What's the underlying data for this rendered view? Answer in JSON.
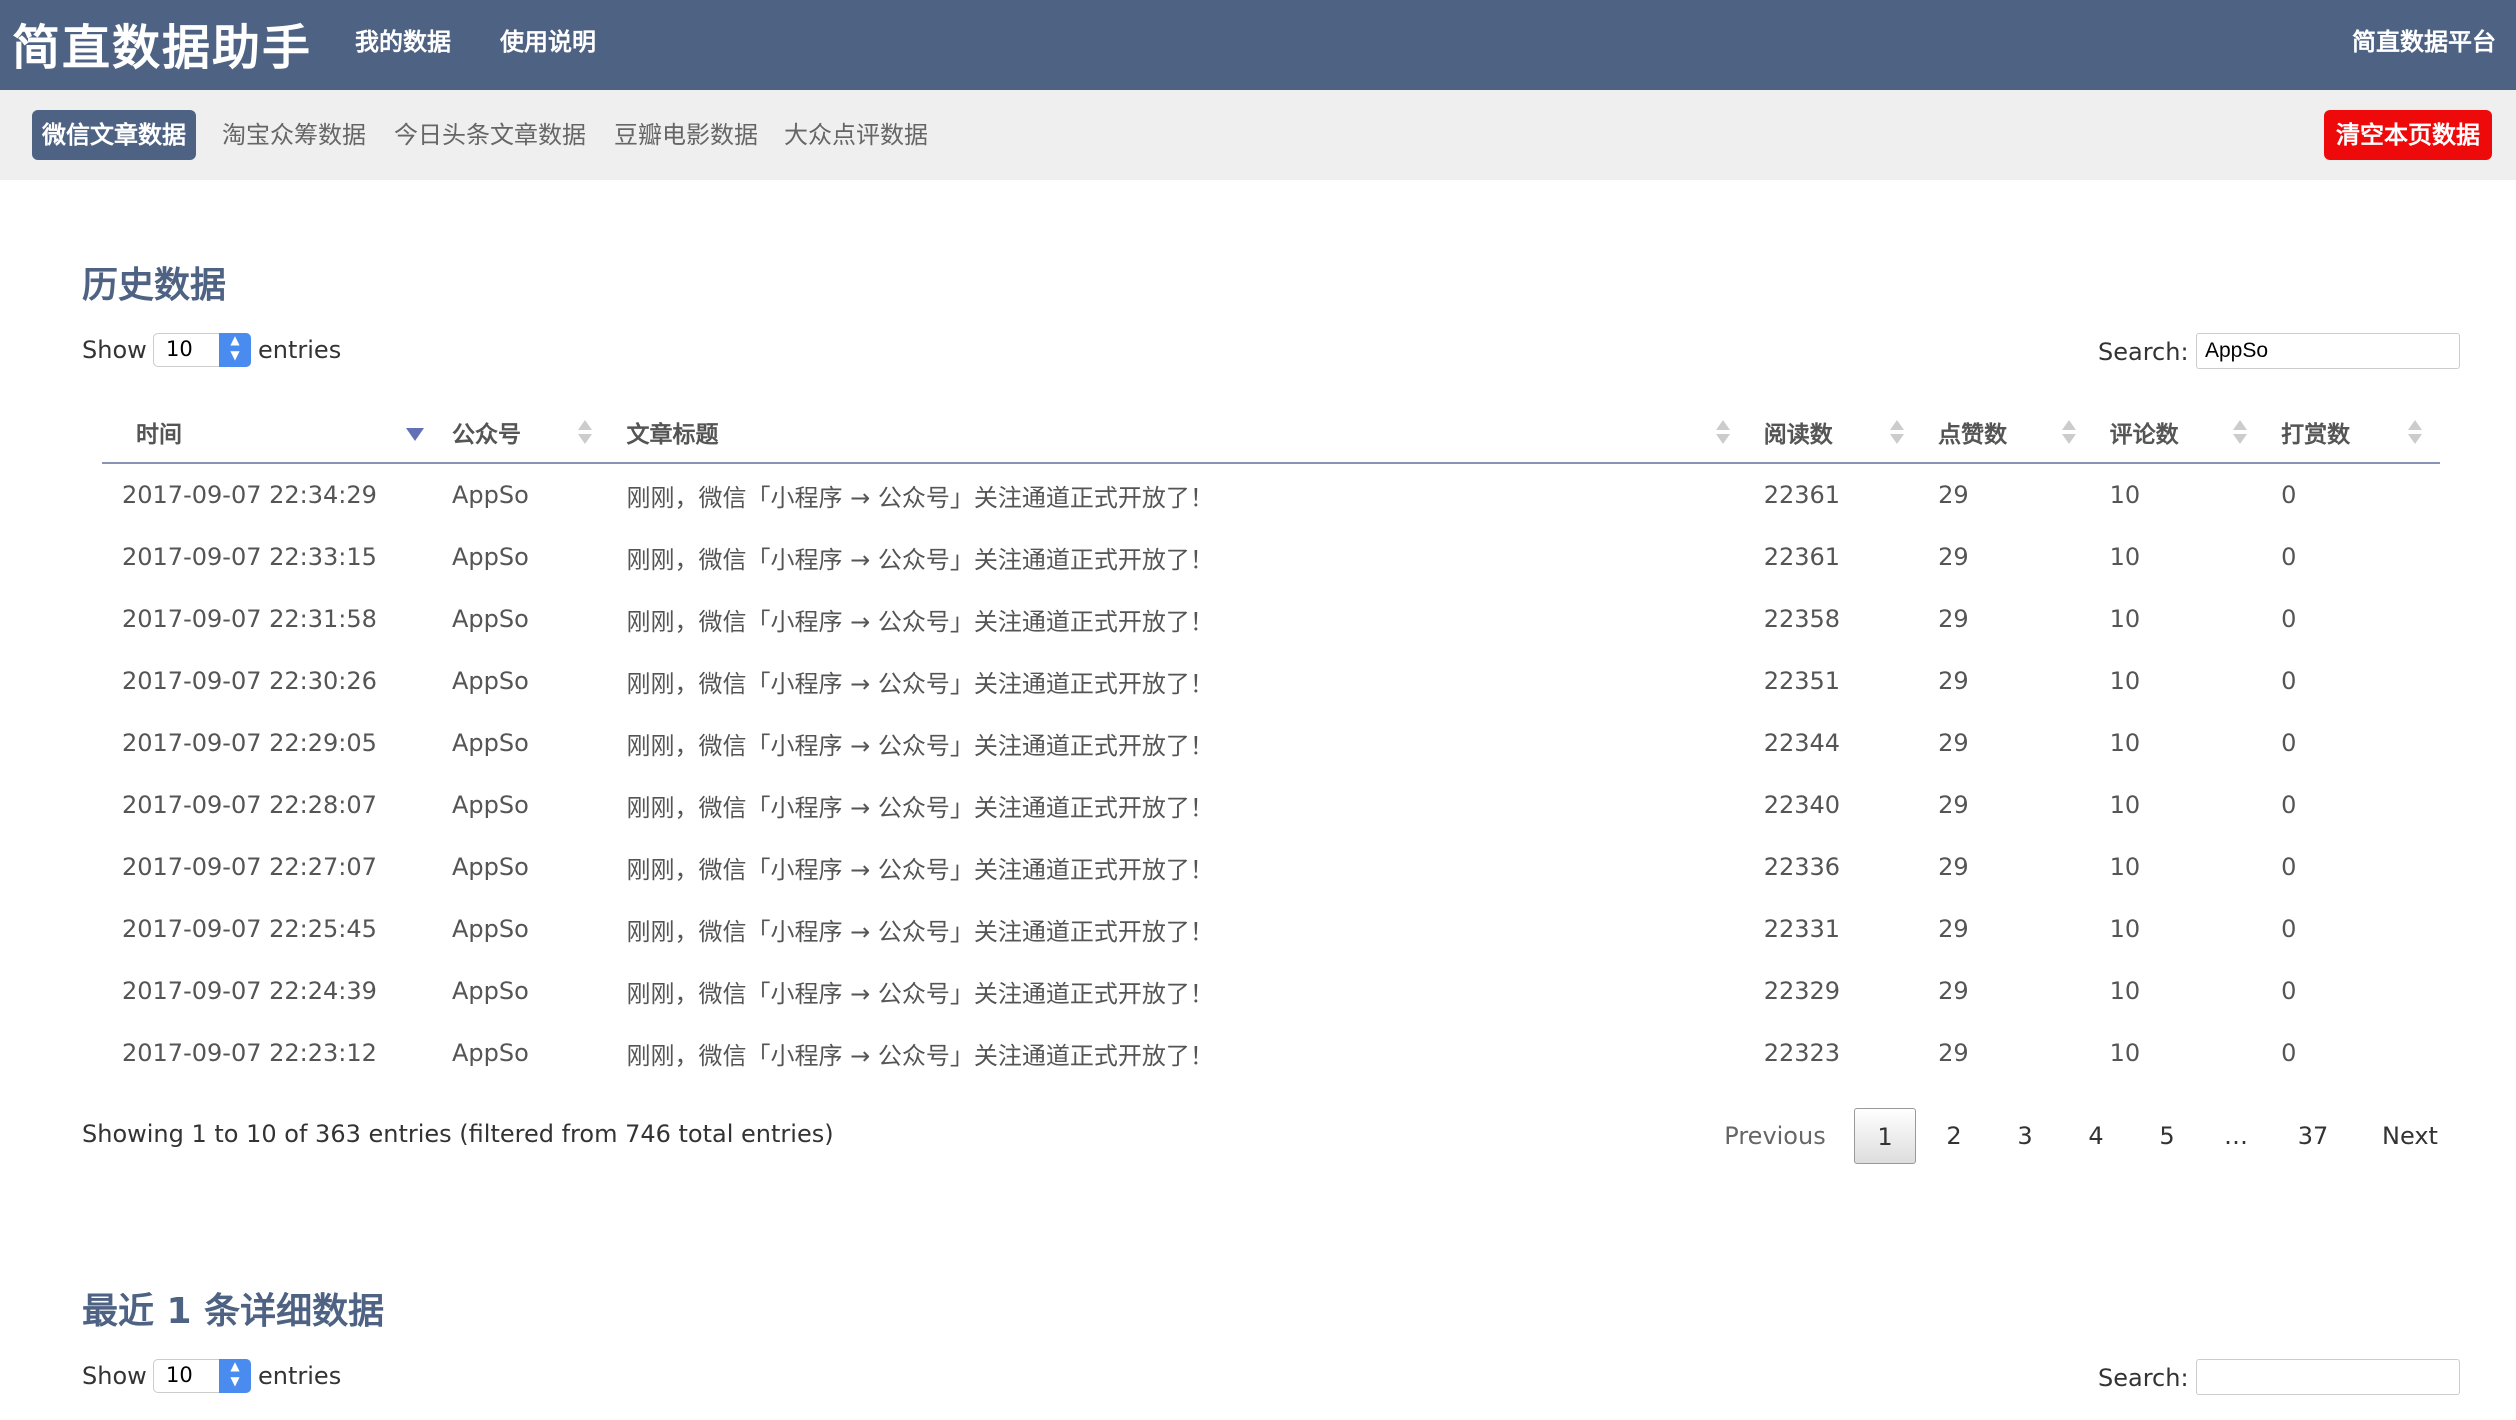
{
  "navbar": {
    "brand": "简直数据助手",
    "links": [
      "我的数据",
      "使用说明"
    ],
    "right_link": "简直数据平台"
  },
  "subnav": {
    "pills": [
      "微信文章数据",
      "淘宝众筹数据",
      "今日头条文章数据",
      "豆瓣电影数据",
      "大众点评数据"
    ],
    "active_index": 0,
    "clear_button": "清空本页数据"
  },
  "history": {
    "title": "历史数据",
    "show_label": "Show",
    "page_size": "10",
    "entries_label": "entries",
    "search_label": "Search:",
    "search_value": "AppSo",
    "columns": [
      "时间",
      "公众号",
      "文章标题",
      "阅读数",
      "点赞数",
      "评论数",
      "打赏数"
    ],
    "rows": [
      [
        "2017-09-07 22:34:29",
        "AppSo",
        "刚刚，微信「小程序 → 公众号」关注通道正式开放了！",
        "22361",
        "29",
        "10",
        "0"
      ],
      [
        "2017-09-07 22:33:15",
        "AppSo",
        "刚刚，微信「小程序 → 公众号」关注通道正式开放了！",
        "22361",
        "29",
        "10",
        "0"
      ],
      [
        "2017-09-07 22:31:58",
        "AppSo",
        "刚刚，微信「小程序 → 公众号」关注通道正式开放了！",
        "22358",
        "29",
        "10",
        "0"
      ],
      [
        "2017-09-07 22:30:26",
        "AppSo",
        "刚刚，微信「小程序 → 公众号」关注通道正式开放了！",
        "22351",
        "29",
        "10",
        "0"
      ],
      [
        "2017-09-07 22:29:05",
        "AppSo",
        "刚刚，微信「小程序 → 公众号」关注通道正式开放了！",
        "22344",
        "29",
        "10",
        "0"
      ],
      [
        "2017-09-07 22:28:07",
        "AppSo",
        "刚刚，微信「小程序 → 公众号」关注通道正式开放了！",
        "22340",
        "29",
        "10",
        "0"
      ],
      [
        "2017-09-07 22:27:07",
        "AppSo",
        "刚刚，微信「小程序 → 公众号」关注通道正式开放了！",
        "22336",
        "29",
        "10",
        "0"
      ],
      [
        "2017-09-07 22:25:45",
        "AppSo",
        "刚刚，微信「小程序 → 公众号」关注通道正式开放了！",
        "22331",
        "29",
        "10",
        "0"
      ],
      [
        "2017-09-07 22:24:39",
        "AppSo",
        "刚刚，微信「小程序 → 公众号」关注通道正式开放了！",
        "22329",
        "29",
        "10",
        "0"
      ],
      [
        "2017-09-07 22:23:12",
        "AppSo",
        "刚刚，微信「小程序 → 公众号」关注通道正式开放了！",
        "22323",
        "29",
        "10",
        "0"
      ]
    ],
    "info": "Showing 1 to 10 of 363 entries (filtered from 746 total entries)",
    "pagination": {
      "previous": "Previous",
      "pages": [
        "1",
        "2",
        "3",
        "4",
        "5",
        "…",
        "37"
      ],
      "current": "1",
      "next": "Next"
    }
  },
  "detail": {
    "title": "最近 1 条详细数据",
    "show_label": "Show",
    "page_size": "10",
    "entries_label": "entries",
    "search_label": "Search:",
    "search_value": ""
  },
  "colors": {
    "navbar": "#4e6283",
    "subnav_bg": "#efefef",
    "clear_button": "#ee0a0a",
    "select_arrow": "#4a8bef"
  }
}
